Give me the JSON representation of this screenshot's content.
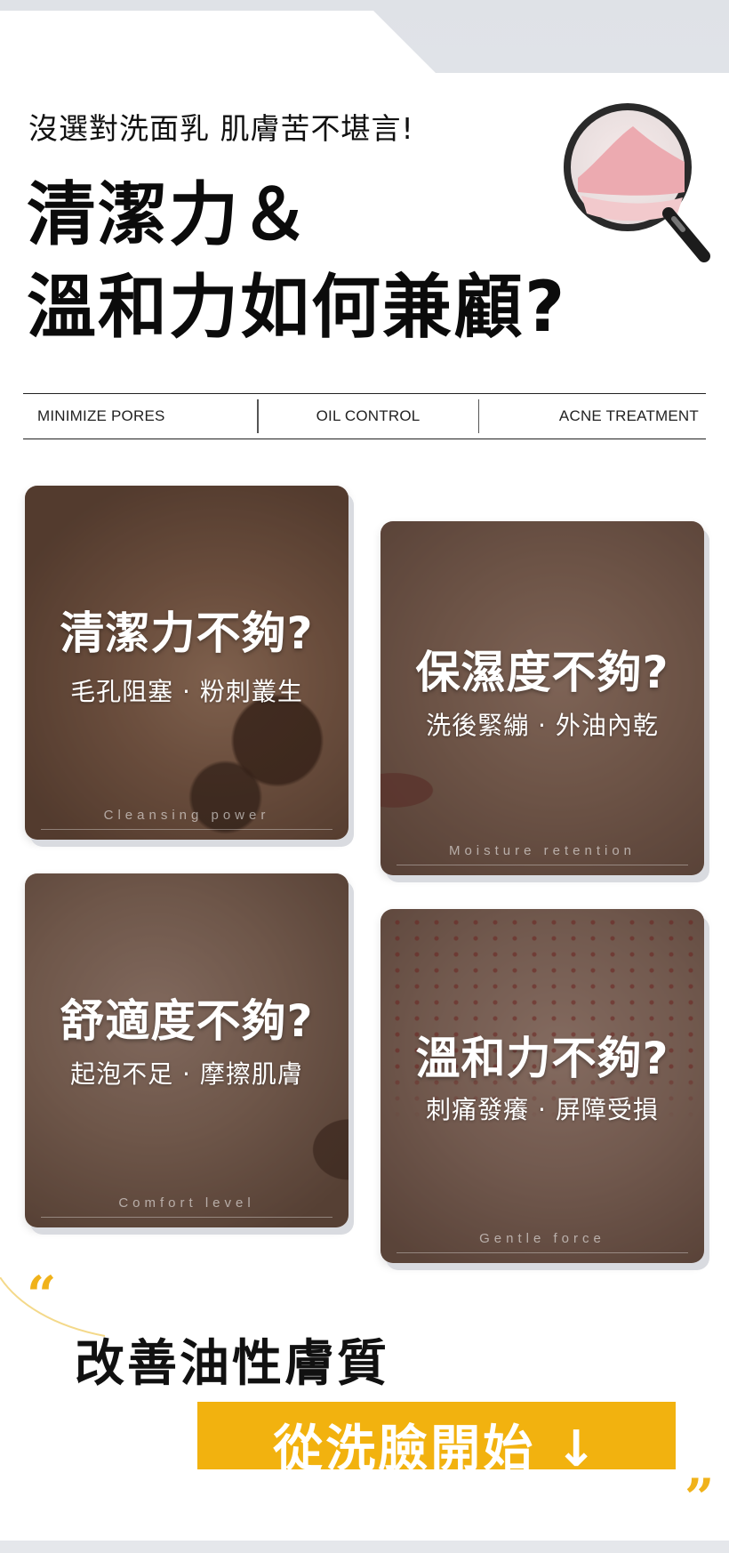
{
  "header": {
    "subtitle": "沒選對洗面乳 肌膚苦不堪言!",
    "headline_line1": "清潔力＆",
    "headline_line2": "溫和力如何兼顧?"
  },
  "features": [
    "MINIMIZE PORES",
    "OIL CONTROL",
    "ACNE TREATMENT"
  ],
  "cards": [
    {
      "title": "清潔力不夠?",
      "desc": "毛孔阻塞 · 粉刺叢生",
      "en": "Cleansing power"
    },
    {
      "title": "保濕度不夠?",
      "desc": "洗後緊繃 · 外油內乾",
      "en": "Moisture retention"
    },
    {
      "title": "舒適度不夠?",
      "desc": "起泡不足 · 摩擦肌膚",
      "en": "Comfort level"
    },
    {
      "title": "溫和力不夠?",
      "desc": "刺痛發癢 · 屏障受損",
      "en": "Gentle force"
    }
  ],
  "closing": {
    "line1": "改善油性膚質",
    "cta": "從洗臉開始 ↓",
    "quote_open": "“",
    "quote_close": "”"
  },
  "colors": {
    "accent": "#f2b20f",
    "text": "#111111"
  },
  "icons": [
    "magnifier-icon",
    "quote-open-icon",
    "quote-close-icon"
  ]
}
